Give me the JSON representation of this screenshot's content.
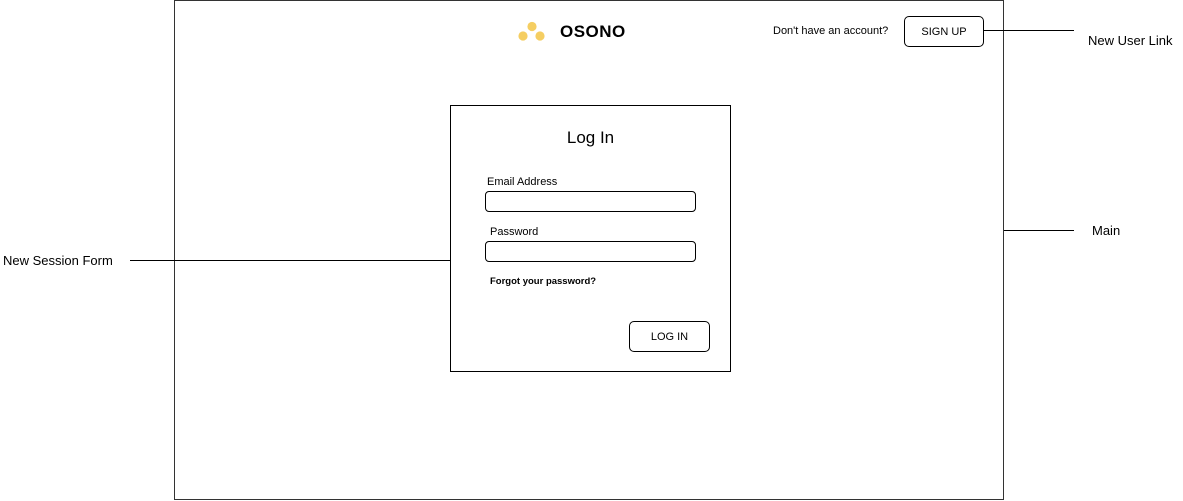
{
  "brand": {
    "name": "OSONO",
    "logo_color": "#F5CE62",
    "logo_icon": "three-dots-icon"
  },
  "header": {
    "signup_prompt": "Don't have an account?",
    "signup_label": "SIGN UP"
  },
  "form": {
    "title": "Log In",
    "email_label": "Email Address",
    "email_value": "",
    "password_label": "Password",
    "password_value": "",
    "forgot_label": "Forgot your password?",
    "login_label": "LOG IN"
  },
  "annotations": {
    "new_user_link": "New User Link",
    "main": "Main",
    "new_session_form": "New Session Form"
  }
}
